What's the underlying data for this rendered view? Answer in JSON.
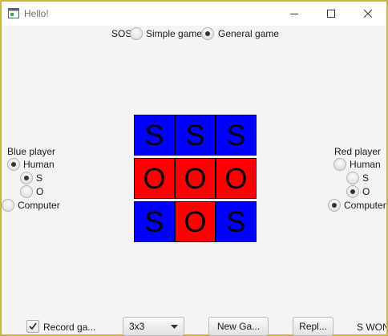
{
  "window": {
    "title": "Hello!"
  },
  "mode": {
    "label": "SOS",
    "options": [
      {
        "label": "Simple game",
        "selected": false
      },
      {
        "label": "General game",
        "selected": true
      }
    ]
  },
  "blue": {
    "title": "Blue player",
    "human": "Human",
    "s": "S",
    "o": "O",
    "computer": "Computer",
    "selected_player": "Human",
    "selected_letter": "S",
    "color": "#0000ff"
  },
  "red": {
    "title": "Red player",
    "human": "Human",
    "s": "S",
    "o": "O",
    "computer": "Computer",
    "selected_player": "Computer",
    "selected_letter": "O",
    "color": "#ff0000"
  },
  "board": {
    "size": 3,
    "cells": [
      {
        "letter": "S",
        "color": "#0000ff"
      },
      {
        "letter": "S",
        "color": "#0000ff"
      },
      {
        "letter": "S",
        "color": "#0000ff"
      },
      {
        "letter": "O",
        "color": "#ff0000"
      },
      {
        "letter": "O",
        "color": "#ff0000"
      },
      {
        "letter": "O",
        "color": "#ff0000"
      },
      {
        "letter": "S",
        "color": "#0000ff"
      },
      {
        "letter": "O",
        "color": "#ff0000"
      },
      {
        "letter": "S",
        "color": "#0000ff"
      }
    ]
  },
  "bottom": {
    "record_label": "Record ga...",
    "record_checked": true,
    "size_value": "3x3",
    "new_game_label": "New Ga...",
    "replay_label": "Repl...",
    "status": "S WON"
  }
}
